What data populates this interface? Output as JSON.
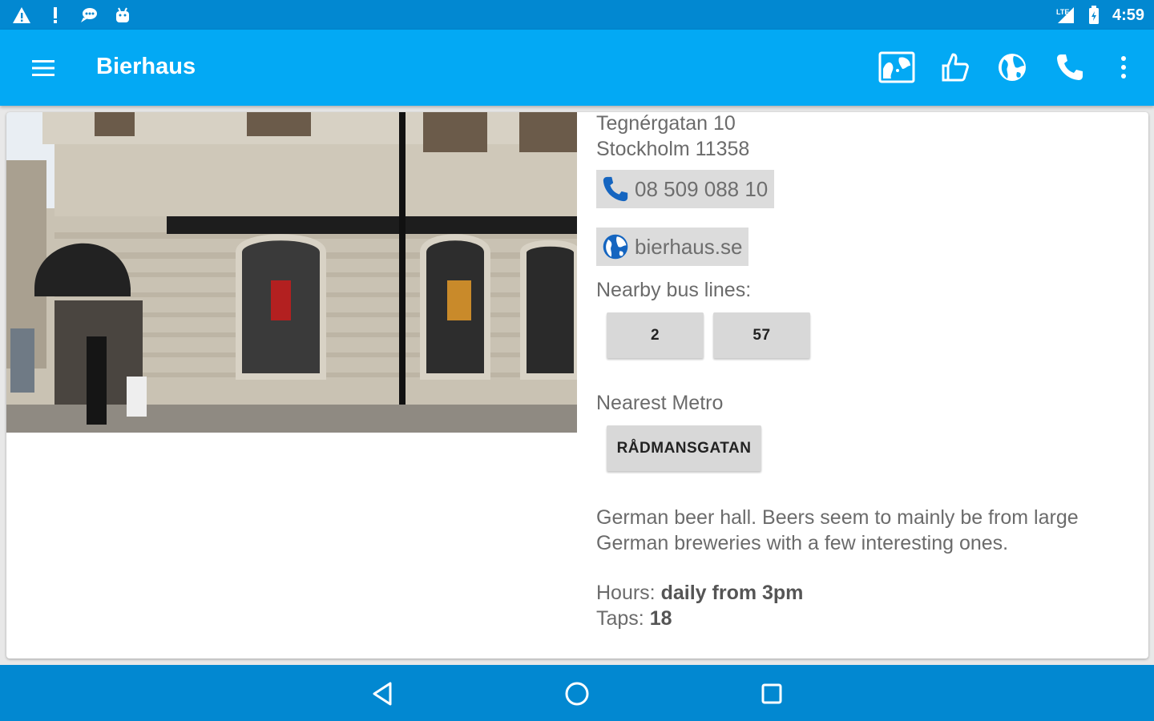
{
  "status_bar": {
    "left_icons": [
      "warning-icon",
      "exclamation-icon",
      "chat-icon",
      "android-icon"
    ],
    "right_icons": [
      "signal-icon",
      "battery-icon"
    ],
    "time": "4:59"
  },
  "app_bar": {
    "title": "Bierhaus",
    "actions": [
      "map-icon",
      "thumbs-up-icon",
      "globe-icon",
      "phone-icon",
      "more-vert-icon"
    ]
  },
  "venue": {
    "address_line1": "Tegnérgatan 10",
    "address_line2": "Stockholm 11358",
    "phone": "08 509 088 10",
    "website": "bierhaus.se",
    "nearby_bus_label": "Nearby bus lines:",
    "bus_lines": [
      "2",
      "57"
    ],
    "nearest_metro_label": "Nearest Metro",
    "metro": "RÅDMANSGATAN",
    "description": "German beer hall. Beers seem to mainly be from large German breweries with a few interesting ones.",
    "hours_label": "Hours: ",
    "hours_value": "daily from 3pm",
    "taps_label": "Taps: ",
    "taps_value": "18"
  },
  "nav_bar": {
    "buttons": [
      "back-icon",
      "home-icon",
      "recents-icon"
    ]
  },
  "colors": {
    "status_bar": "#0288d1",
    "app_bar": "#03a9f4",
    "chip_bg": "#dcdcdc",
    "link_blue": "#1565c0"
  }
}
